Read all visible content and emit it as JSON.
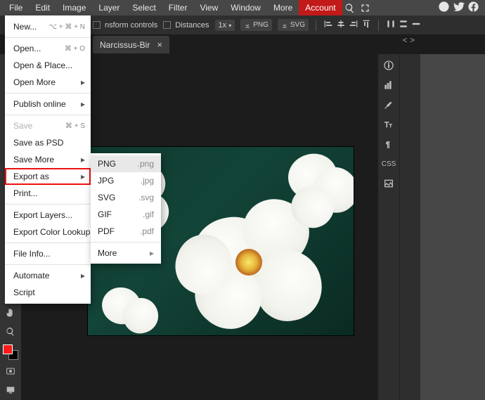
{
  "menubar": {
    "items": [
      "File",
      "Edit",
      "Image",
      "Layer",
      "Select",
      "Filter",
      "View",
      "Window",
      "More"
    ],
    "account": "Account"
  },
  "toolbar": {
    "transform_label": "nsform controls",
    "distances_label": "Distances",
    "zoom": "1x",
    "png_label": "PNG",
    "svg_label": "SVG"
  },
  "tab": {
    "title": "Narcissus-Bir"
  },
  "file_menu": {
    "new": "New...",
    "new_sc": "⌥ + ⌘ + N",
    "open": "Open...",
    "open_sc": "⌘ + O",
    "open_place": "Open & Place...",
    "open_more": "Open More",
    "publish": "Publish online",
    "save": "Save",
    "save_sc": "⌘ + S",
    "save_psd": "Save as PSD",
    "save_more": "Save More",
    "export_as": "Export as",
    "print": "Print...",
    "export_layers": "Export Layers...",
    "export_clut": "Export Color Lookup...",
    "file_info": "File Info...",
    "automate": "Automate",
    "script": "Script"
  },
  "export_submenu": {
    "items": [
      {
        "label": "PNG",
        "ext": ".png",
        "selected": true
      },
      {
        "label": "JPG",
        "ext": ".jpg"
      },
      {
        "label": "SVG",
        "ext": ".svg"
      },
      {
        "label": "GIF",
        "ext": ".gif"
      },
      {
        "label": "PDF",
        "ext": ".pdf"
      }
    ],
    "more": "More"
  },
  "right_panel": {
    "css_label": "CSS"
  },
  "colors": {
    "accent_red": "#c21919",
    "highlight_red": "#e11",
    "foreground_swatch": "#ff1a1a",
    "background_swatch": "#000000"
  }
}
